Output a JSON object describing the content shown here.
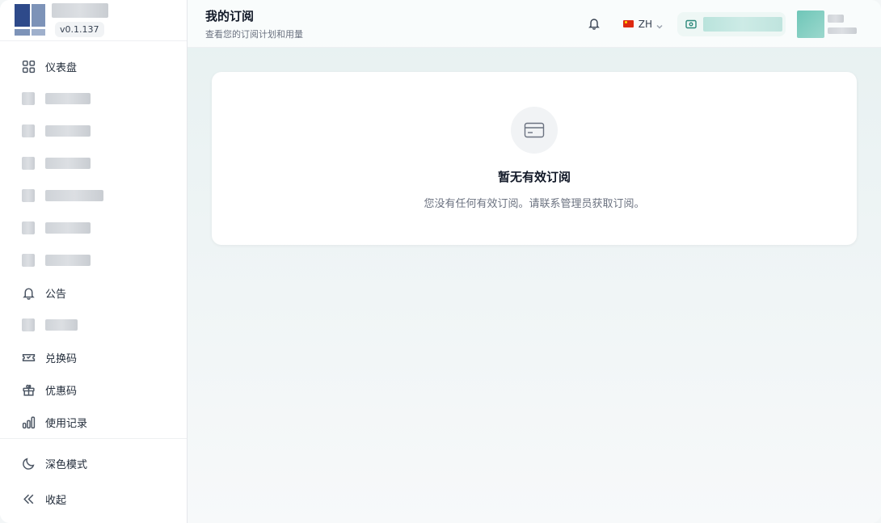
{
  "sidebar": {
    "version": "v0.1.137",
    "items": [
      {
        "label": "仪表盘",
        "icon": "dashboard-grid-icon",
        "redacted": false
      },
      {
        "label": "",
        "redacted": true,
        "w": 56
      },
      {
        "label": "",
        "redacted": true,
        "w": 56
      },
      {
        "label": "",
        "redacted": true,
        "w": 56
      },
      {
        "label": "",
        "redacted": true,
        "w": 72
      },
      {
        "label": "",
        "redacted": true,
        "w": 56
      },
      {
        "label": "",
        "redacted": true,
        "w": 56
      },
      {
        "label": "公告",
        "icon": "bell-icon",
        "redacted": false
      },
      {
        "label": "",
        "redacted": true,
        "w": 40
      },
      {
        "label": "兑换码",
        "icon": "ticket-icon",
        "redacted": false
      },
      {
        "label": "优惠码",
        "icon": "gift-icon",
        "redacted": false
      },
      {
        "label": "使用记录",
        "icon": "bar-chart-icon",
        "redacted": false
      }
    ],
    "bottom": [
      {
        "label": "深色模式",
        "icon": "moon-icon"
      },
      {
        "label": "收起",
        "icon": "collapse-chevrons-icon"
      }
    ]
  },
  "header": {
    "title": "我的订阅",
    "subtitle": "查看您的订阅计划和用量",
    "language": "ZH"
  },
  "empty_state": {
    "title": "暂无有效订阅",
    "description": "您没有任何有效订阅。请联系管理员获取订阅。",
    "icon": "credit-card-icon"
  }
}
